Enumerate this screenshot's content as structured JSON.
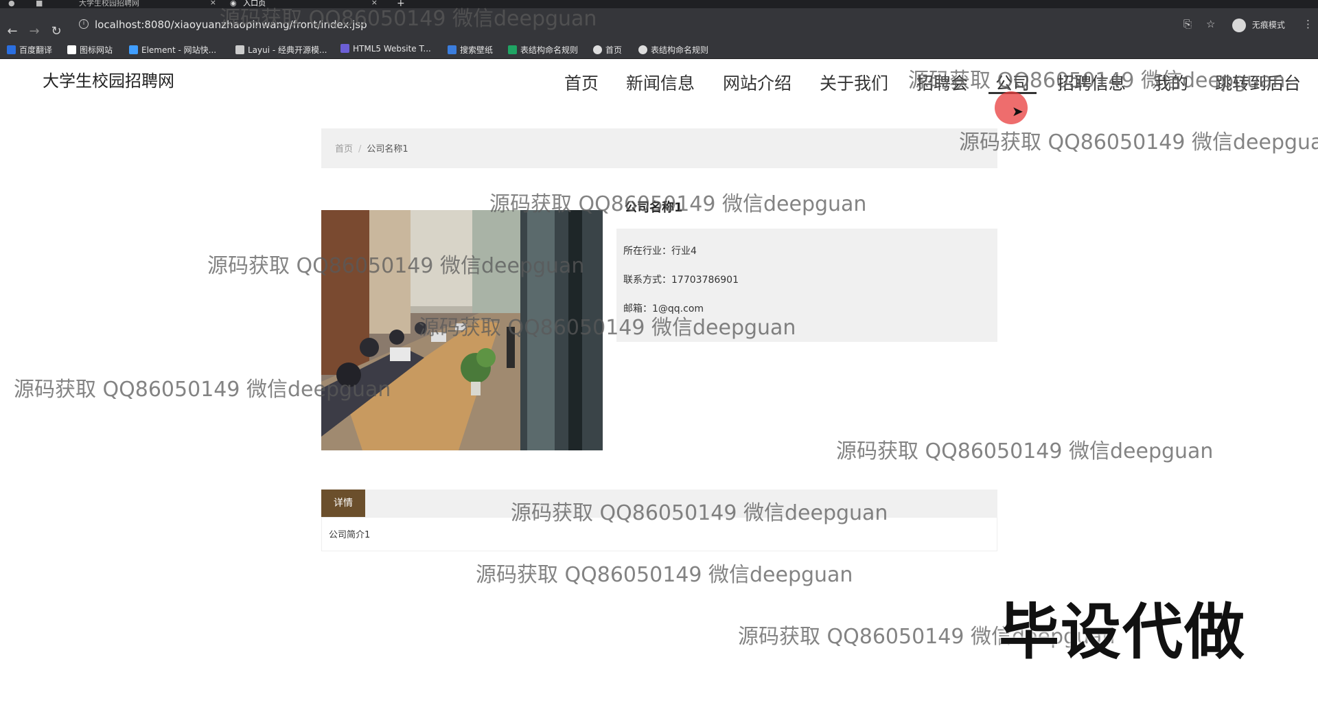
{
  "browser": {
    "tabs": [
      {
        "title": "大学生校园招聘网"
      },
      {
        "title": "入口页"
      }
    ],
    "new_tab": "+",
    "url": "localhost:8080/xiaoyuanzhaopinwang/front/index.jsp",
    "profile_label": "无痕模式",
    "bookmarks": [
      {
        "label": "百度翻译",
        "color": "#2b6fe0"
      },
      {
        "label": "图标网站",
        "color": "#ffffff"
      },
      {
        "label": "Element - 网站快...",
        "color": "#409eff"
      },
      {
        "label": "Layui - 经典开源模...",
        "color": "#cccccc"
      },
      {
        "label": "HTML5 Website T...",
        "color": "#6c5fd6"
      },
      {
        "label": "搜索壁纸",
        "color": "#3b7ddd"
      },
      {
        "label": "表结构命名规则",
        "color": "#1fa463"
      },
      {
        "label": "首页",
        "color": "#dddddd"
      },
      {
        "label": "表结构命名规则",
        "color": "#dddddd"
      }
    ]
  },
  "site": {
    "title": "大学生校园招聘网",
    "nav": [
      "首页",
      "新闻信息",
      "网站介绍",
      "关于我们",
      "招聘会",
      "公司",
      "招聘信息",
      "我的",
      "跳转到后台"
    ],
    "active_nav": "公司"
  },
  "breadcrumb": {
    "home": "首页",
    "separator": "/",
    "current": "公司名称1"
  },
  "company": {
    "name": "公司名称1",
    "industry_label": "所在行业：",
    "industry": "行业4",
    "phone_label": "联系方式：",
    "phone": "17703786901",
    "email_label": "邮箱：",
    "email": "1@qq.com"
  },
  "detail": {
    "tab_label": "详情",
    "content": "公司简介1"
  },
  "watermarks": {
    "text": "源码获取 QQ86050149 微信deepguan",
    "stamp": "毕设代做"
  },
  "colors": {
    "detail_tab": "#6b4f2c",
    "chrome_bg": "#35363a"
  }
}
